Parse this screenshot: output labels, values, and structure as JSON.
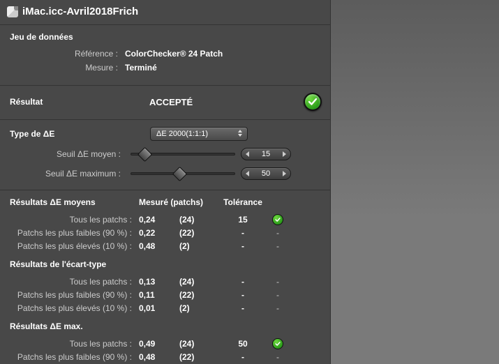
{
  "title": "iMac.icc-Avril2018Frich",
  "dataset": {
    "heading": "Jeu de données",
    "reference_label": "Référence :",
    "reference_value": "ColorChecker® 24 Patch",
    "measure_label": "Mesure :",
    "measure_value": "Terminé"
  },
  "result": {
    "label": "Résultat",
    "value": "ACCEPTÉ"
  },
  "deltaE": {
    "type_label": "Type de ΔE",
    "type_value": "ΔE 2000(1:1:1)",
    "mean_threshold_label": "Seuil ΔE moyen :",
    "mean_threshold_value": "15",
    "max_threshold_label": "Seuil ΔE maximum :",
    "max_threshold_value": "50"
  },
  "headers": {
    "measured": "Mesuré (patchs)",
    "tolerance": "Tolérance"
  },
  "groups": [
    {
      "title": "Résultats ΔE moyens",
      "rows": [
        {
          "label": "Tous les patchs :",
          "mes": "0,24",
          "pat": "(24)",
          "tol": "15",
          "ok": true
        },
        {
          "label": "Patchs les plus faibles (90 %) :",
          "mes": "0,22",
          "pat": "(22)",
          "tol": "-",
          "ok": false
        },
        {
          "label": "Patchs les plus élevés (10 %) :",
          "mes": "0,48",
          "pat": "(2)",
          "tol": "-",
          "ok": false
        }
      ]
    },
    {
      "title": "Résultats de l'écart-type",
      "rows": [
        {
          "label": "Tous les patchs :",
          "mes": "0,13",
          "pat": "(24)",
          "tol": "-",
          "ok": false
        },
        {
          "label": "Patchs les plus faibles (90 %) :",
          "mes": "0,11",
          "pat": "(22)",
          "tol": "-",
          "ok": false
        },
        {
          "label": "Patchs les plus élevés (10 %) :",
          "mes": "0,01",
          "pat": "(2)",
          "tol": "-",
          "ok": false
        }
      ]
    },
    {
      "title": "Résultats ΔE max.",
      "rows": [
        {
          "label": "Tous les patchs :",
          "mes": "0,49",
          "pat": "(24)",
          "tol": "50",
          "ok": true
        },
        {
          "label": "Patchs les plus faibles (90 %) :",
          "mes": "0,48",
          "pat": "(22)",
          "tol": "-",
          "ok": false
        }
      ]
    }
  ]
}
